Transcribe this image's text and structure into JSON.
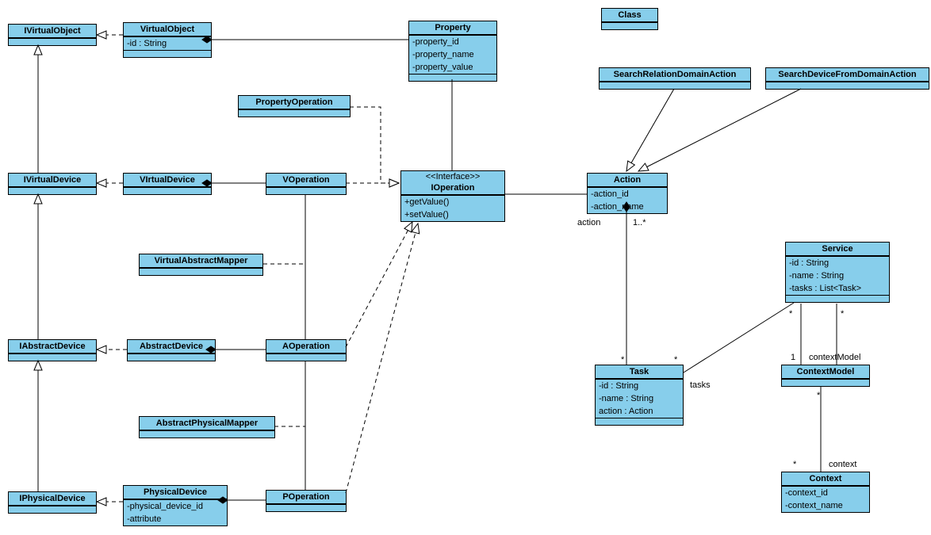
{
  "classes": {
    "IVirtualObject": {
      "name": "IVirtualObject"
    },
    "VirtualObject": {
      "name": "VirtualObject",
      "attrs": [
        "-id : String"
      ]
    },
    "Property": {
      "name": "Property",
      "attrs": [
        "-property_id",
        "-property_name",
        "-property_value"
      ]
    },
    "Class": {
      "name": "Class"
    },
    "PropertyOperation": {
      "name": "PropertyOperation"
    },
    "SearchRelationDomainAction": {
      "name": "SearchRelationDomainAction"
    },
    "SearchDeviceFromDomainAction": {
      "name": "SearchDeviceFromDomainAction"
    },
    "IVirtualDevice": {
      "name": "IVirtualDevice"
    },
    "VIrtualDevice": {
      "name": "VIrtualDevice"
    },
    "VOperation": {
      "name": "VOperation"
    },
    "IOperation": {
      "stereo": "<<Interface>>",
      "name": "IOperation",
      "ops": [
        "+getValue()",
        "+setValue()"
      ]
    },
    "Action": {
      "name": "Action",
      "attrs": [
        "-action_id",
        "-action_name"
      ]
    },
    "VirtualAbstractMapper": {
      "name": "VirtualAbstractMapper"
    },
    "Service": {
      "name": "Service",
      "attrs": [
        "-id : String",
        "-name : String",
        "-tasks : List<Task>"
      ]
    },
    "IAbstractDevice": {
      "name": "IAbstractDevice"
    },
    "AbstractDevice": {
      "name": "AbstractDevice"
    },
    "AOperation": {
      "name": "AOperation"
    },
    "Task": {
      "name": "Task",
      "attrs": [
        "-id : String",
        "-name : String",
        "action : Action"
      ]
    },
    "ContextModel": {
      "name": "ContextModel"
    },
    "AbstractPhysicalMapper": {
      "name": "AbstractPhysicalMapper"
    },
    "IPhysicalDevice": {
      "name": "IPhysicalDevice"
    },
    "PhysicalDevice": {
      "name": "PhysicalDevice",
      "attrs": [
        "-physical_device_id",
        "-attribute"
      ]
    },
    "POperation": {
      "name": "POperation"
    },
    "Context": {
      "name": "Context",
      "attrs": [
        "-context_id",
        "-context_name"
      ]
    }
  },
  "labels": {
    "action": "action",
    "one_star": "1..*",
    "star": "*",
    "tasks": "tasks",
    "one": "1",
    "contextModel": "contextModel",
    "context": "context"
  }
}
